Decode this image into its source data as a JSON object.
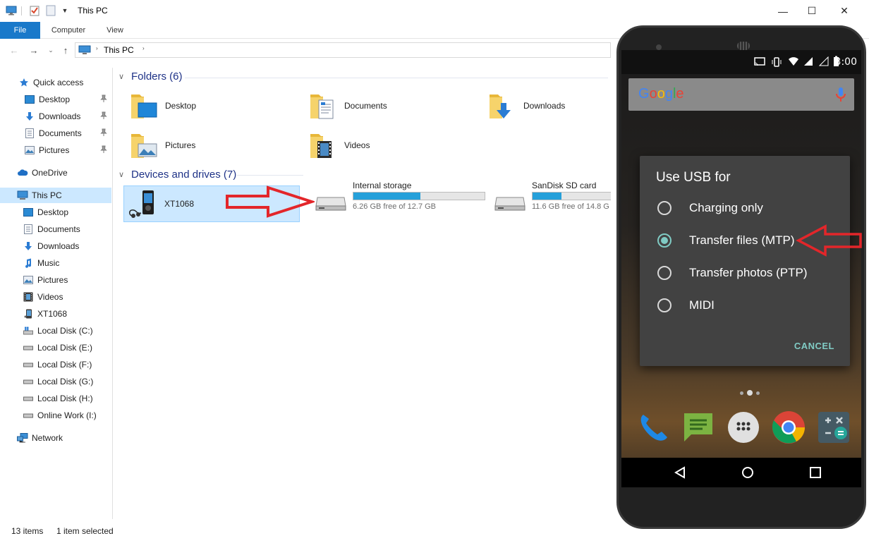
{
  "window": {
    "title": "This PC",
    "controls": {
      "minimize": "—",
      "maximize": "☐",
      "close": "✕"
    }
  },
  "ribbon": {
    "tabs": [
      {
        "label": "File"
      },
      {
        "label": "Computer"
      },
      {
        "label": "View"
      }
    ]
  },
  "address": {
    "path": "This PC",
    "separator": "›"
  },
  "sidebar": {
    "items": [
      {
        "label": "Quick access",
        "icon": "star-icon"
      },
      {
        "label": "Desktop",
        "icon": "desktop-icon",
        "pinned": true
      },
      {
        "label": "Downloads",
        "icon": "downloads-icon",
        "pinned": true
      },
      {
        "label": "Documents",
        "icon": "documents-icon",
        "pinned": true
      },
      {
        "label": "Pictures",
        "icon": "pictures-icon",
        "pinned": true
      },
      {
        "label": "OneDrive",
        "icon": "cloud-icon"
      },
      {
        "label": "This PC",
        "icon": "computer-icon",
        "selected": true
      },
      {
        "label": "Desktop",
        "icon": "desktop-icon"
      },
      {
        "label": "Documents",
        "icon": "documents-icon"
      },
      {
        "label": "Downloads",
        "icon": "downloads-icon"
      },
      {
        "label": "Music",
        "icon": "music-icon"
      },
      {
        "label": "Pictures",
        "icon": "pictures-icon"
      },
      {
        "label": "Videos",
        "icon": "videos-icon"
      },
      {
        "label": "XT1068",
        "icon": "phone-icon"
      },
      {
        "label": "Local Disk (C:)",
        "icon": "drive-icon"
      },
      {
        "label": "Local Disk (E:)",
        "icon": "drive-icon"
      },
      {
        "label": "Local Disk (F:)",
        "icon": "drive-icon"
      },
      {
        "label": "Local Disk (G:)",
        "icon": "drive-icon"
      },
      {
        "label": "Local Disk (H:)",
        "icon": "drive-icon"
      },
      {
        "label": "Online Work (I:)",
        "icon": "drive-icon"
      },
      {
        "label": "Network",
        "icon": "network-icon"
      }
    ]
  },
  "folders": {
    "header": "Folders (6)",
    "items": [
      {
        "label": "Desktop",
        "icon": "desktop-folder-icon"
      },
      {
        "label": "Documents",
        "icon": "documents-folder-icon"
      },
      {
        "label": "Downloads",
        "icon": "downloads-folder-icon"
      },
      {
        "label": "Pictures",
        "icon": "pictures-folder-icon"
      },
      {
        "label": "Videos",
        "icon": "videos-folder-icon"
      }
    ]
  },
  "devices": {
    "header": "Devices and drives (7)",
    "items": [
      {
        "label": "XT1068",
        "icon": "media-player-icon",
        "selected": true
      },
      {
        "label": "Internal storage",
        "free": "6.26 GB free of 12.7 GB",
        "used_fraction": 0.51,
        "icon": "drive-icon"
      },
      {
        "label": "SanDisk SD card",
        "free": "11.6 GB free of 14.8 G",
        "used_fraction": 0.22,
        "icon": "drive-icon"
      }
    ]
  },
  "status": {
    "items": "13 items",
    "selected": "1 item selected"
  },
  "phone": {
    "time": "3:00",
    "search_logo": "Google",
    "dialog": {
      "title": "Use USB for",
      "options": [
        {
          "label": "Charging only",
          "selected": false
        },
        {
          "label": "Transfer files (MTP)",
          "selected": true
        },
        {
          "label": "Transfer photos (PTP)",
          "selected": false
        },
        {
          "label": "MIDI",
          "selected": false
        }
      ],
      "cancel": "CANCEL"
    },
    "dock": [
      "phone-app-icon",
      "messages-app-icon",
      "app-drawer-icon",
      "chrome-app-icon",
      "calculator-app-icon"
    ]
  },
  "colors": {
    "accent": "#1979ca",
    "selection": "#cce8ff",
    "bar_fill": "#26a0da",
    "group_header": "#1e3287",
    "android_accent": "#80cbc4",
    "arrow": "#e3262a"
  }
}
